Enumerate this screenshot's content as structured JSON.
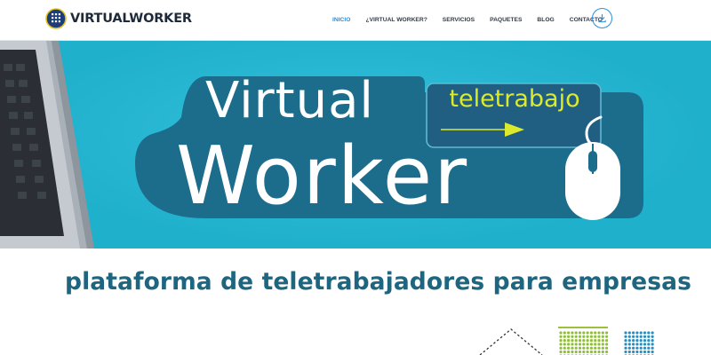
{
  "header": {
    "brand_name": "VIRTUALWORKER",
    "nav_items": [
      {
        "label": "INICIO",
        "active": true
      },
      {
        "label": "¿VIRTUAL WORKER?",
        "active": false
      },
      {
        "label": "SERVICIOS",
        "active": false
      },
      {
        "label": "PAQUETES",
        "active": false
      },
      {
        "label": "BLOG",
        "active": false
      },
      {
        "label": "CONTACTO",
        "active": false
      }
    ],
    "download_icon": "download-icon"
  },
  "hero": {
    "title_line1": "Virtual",
    "title_line2": "Worker",
    "badge_text": "teletrabajo",
    "colors": {
      "background": "#1fb0cc",
      "panel": "#1c6d8c",
      "accent": "#dcea2e",
      "text": "#ffffff"
    }
  },
  "tagline": "plataforma de teletrabajadores para empresas",
  "colors": {
    "nav_active": "#2d8fd8",
    "nav_text": "#333c48",
    "tagline": "#1e6580"
  }
}
